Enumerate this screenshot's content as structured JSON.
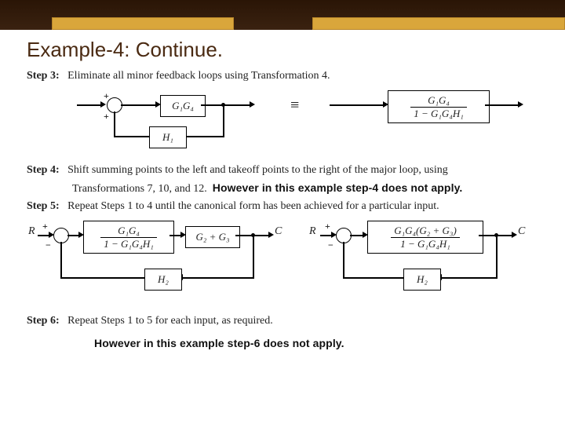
{
  "slide": {
    "title": "Example-4: Continue.",
    "steps": {
      "s3": "Eliminate all minor feedback loops using Transformation 4.",
      "s4a": "Shift summing points to the left and takeoff points to the right of the major loop, using",
      "s4b": "Transformations 7, 10, and 12.",
      "s4note": "However in this example step-4 does not apply.",
      "s5": "Repeat Steps 1 to 4 until the canonical form has been achieved for a particular input.",
      "s6": "Repeat Steps 1 to 5 for each input, as required.",
      "s6note": "However in this example step-6 does not apply."
    },
    "labels": {
      "step3": "Step 3:",
      "step4": "Step 4:",
      "step5": "Step 5:",
      "step6": "Step 6:"
    },
    "blocks": {
      "g1g4": "G₁G₄",
      "h1": "H₁",
      "h2": "H₂",
      "g2g3": "G₂ + G₃",
      "fracA_t": "G₁G₄",
      "fracA_b": "1 − G₁G₄H₁",
      "fracB_t": "G₁G₄(G₂ + G₃)",
      "fracB_b": "1 − G₁G₄H₁",
      "R": "R",
      "C": "C",
      "equiv": "≡"
    },
    "signs": {
      "plus": "+",
      "minus": "−"
    }
  }
}
